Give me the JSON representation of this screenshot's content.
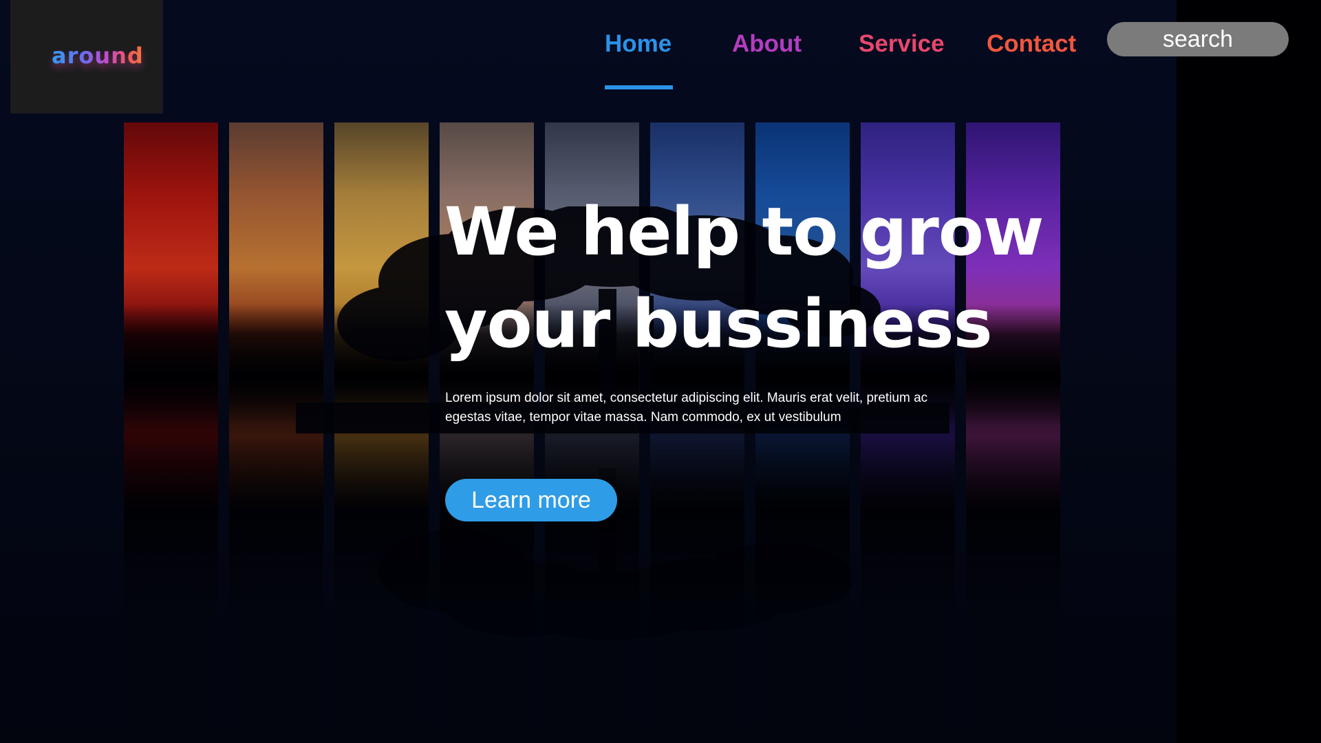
{
  "brand": {
    "logo_text": "around",
    "logo_colors": [
      "#2f9df0",
      "#6b6cf0",
      "#c44bd0",
      "#f05a5a",
      "#f37a3b"
    ]
  },
  "nav": {
    "items": [
      {
        "label": "Home",
        "active": true,
        "color": "#2c92e8"
      },
      {
        "label": "About",
        "active": false,
        "color": "#b43cc0"
      },
      {
        "label": "Service",
        "active": false,
        "color": "#e8476e"
      },
      {
        "label": "Contact",
        "active": false,
        "color": "#f2563f"
      }
    ]
  },
  "search": {
    "placeholder": "search"
  },
  "hero": {
    "title_line1": "We help to grow",
    "title_line2": "your bussiness",
    "description": "Lorem ipsum dolor sit amet, consectetur adipiscing elit. Mauris erat velit, pretium ac egestas vitae, tempor vitae massa. Nam commodo, ex ut vestibulum",
    "cta_label": "Learn more",
    "cta_color": "#2e9ce6"
  },
  "strips": {
    "count": 9,
    "sky_colors": [
      [
        "#7a0a0a",
        "#c0190f",
        "#e8351a",
        "#8a0c0c"
      ],
      [
        "#6f4a3a",
        "#b7693a",
        "#e08a3a",
        "#a3401c"
      ],
      [
        "#6a5530",
        "#c99a45",
        "#f0b84a",
        "#c98a2a"
      ],
      [
        "#6a5a52",
        "#a8877a",
        "#d19a6a",
        "#7a6a70"
      ],
      [
        "#3c4457",
        "#6a7287",
        "#8a8c9a",
        "#4a506a"
      ],
      [
        "#1f3a7a",
        "#3a5ea8",
        "#6a7fb8",
        "#2a3f80"
      ],
      [
        "#0d3f8c",
        "#1b5cb8",
        "#2a63b0",
        "#1a3f88"
      ],
      [
        "#3a2a9a",
        "#5a3ec8",
        "#7a5ae0",
        "#4a2ab0"
      ],
      [
        "#3a1a8a",
        "#6a2ac0",
        "#9a3ae0",
        "#b03aa0"
      ]
    ]
  }
}
